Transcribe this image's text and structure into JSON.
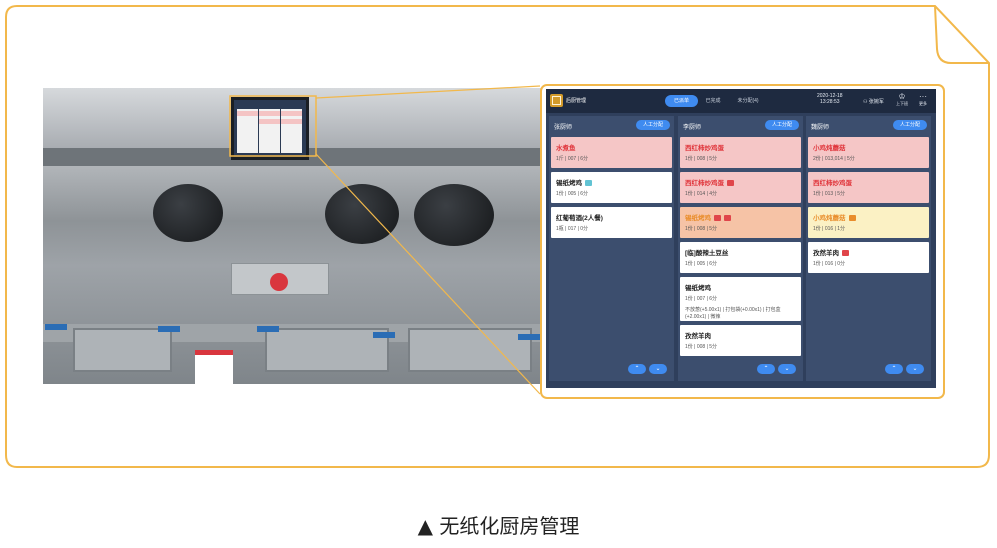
{
  "caption": "▲ 无纸化厨房管理",
  "colors": {
    "frame": "#f2b84b",
    "accent": "#3f8bf0",
    "app_bg": "#2f3f5c"
  },
  "app": {
    "title": "后厨管理",
    "tabs": [
      "已派单",
      "已完成",
      "未分配(4)"
    ],
    "date": "2020-12-18",
    "time": "13:28:53",
    "user": "张婉军",
    "user_icon": "person-icon",
    "actions": [
      {
        "label": "上下班",
        "icon": "chef-hat-icon",
        "glyph": "♔"
      },
      {
        "label": "更多",
        "icon": "more-icon",
        "glyph": "···"
      }
    ],
    "assign_label": "人工分配",
    "columns": [
      {
        "chef": "张厨师",
        "orders": [
          {
            "title": "水煮鱼",
            "meta": "1斤 | 007 | 6分",
            "style": "red",
            "tags": []
          },
          {
            "title": "锡纸烤鸡",
            "meta": "1份 | 005 | 6分",
            "style": "white",
            "tags": [
              "blue"
            ]
          },
          {
            "title": "红葡萄酒(2人餐)",
            "meta": "1瓶 | 017 | 0分",
            "style": "white",
            "tags": []
          }
        ]
      },
      {
        "chef": "李厨师",
        "orders": [
          {
            "title": "西红柿炒鸡蛋",
            "meta": "1份 | 008 | 5分",
            "style": "red",
            "tags": []
          },
          {
            "title": "西红柿炒鸡蛋",
            "meta": "1份 | 014 | 4分",
            "style": "red",
            "tags": [
              "red"
            ]
          },
          {
            "title": "锡纸烤鸡",
            "meta": "1份 | 008 | 5分",
            "style": "orange",
            "tags": [
              "red",
              "red"
            ]
          },
          {
            "title": "[临]酸辣土豆丝",
            "meta": "1份 | 005 | 6分",
            "style": "white",
            "tags": []
          },
          {
            "title": "锡纸烤鸡",
            "meta": "1份 | 007 | 6分",
            "note": "不放葱(+5.00x1) | 打包袋(+0.00x1) | 打包盒(+2.00x1) | 微辣",
            "style": "white",
            "tags": []
          },
          {
            "title": "孜然羊肉",
            "meta": "1份 | 008 | 5分",
            "style": "white",
            "tags": []
          }
        ]
      },
      {
        "chef": "魏厨师",
        "orders": [
          {
            "title": "小鸡炖蘑菇",
            "meta": "2份 | 013,014 | 5分",
            "style": "red",
            "tags": []
          },
          {
            "title": "西红柿炒鸡蛋",
            "meta": "1份 | 013 | 5分",
            "style": "red",
            "tags": []
          },
          {
            "title": "小鸡炖蘑菇",
            "meta": "1份 | 016 | 1分",
            "style": "yellow",
            "tags": [
              "orange"
            ]
          },
          {
            "title": "孜然羊肉",
            "meta": "1份 | 016 | 0分",
            "style": "white",
            "tags": [
              "red"
            ]
          }
        ]
      }
    ],
    "pager": {
      "up": "⌃",
      "down": "⌄"
    }
  }
}
